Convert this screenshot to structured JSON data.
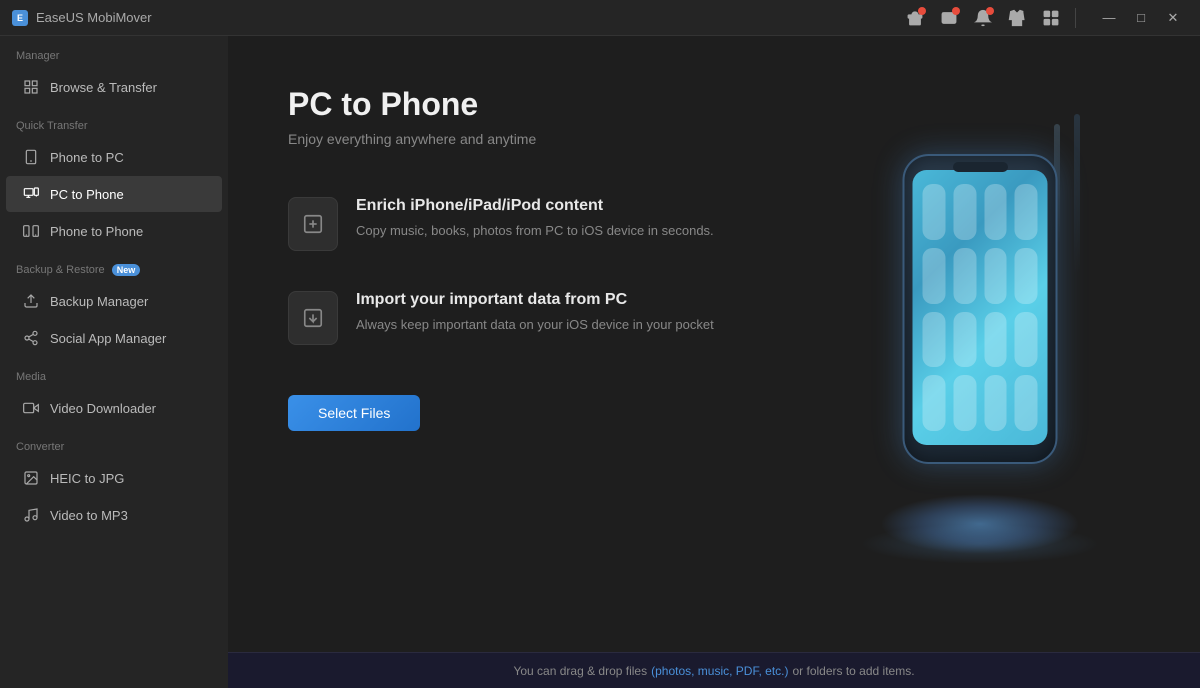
{
  "app": {
    "title": "EaseUS MobiMover",
    "logo_letter": "E"
  },
  "titlebar": {
    "icons": [
      "gift-icon",
      "email-icon",
      "bell-icon",
      "shirt-icon",
      "dropdown-icon"
    ],
    "win_controls": [
      "minimize",
      "maximize",
      "close"
    ]
  },
  "sidebar": {
    "sections": [
      {
        "label": "Manager",
        "items": [
          {
            "id": "browse-transfer",
            "label": "Browse & Transfer",
            "icon": "grid-icon"
          }
        ]
      },
      {
        "label": "Quick Transfer",
        "items": [
          {
            "id": "phone-to-pc",
            "label": "Phone to PC",
            "icon": "phone-icon"
          },
          {
            "id": "pc-to-phone",
            "label": "PC to Phone",
            "icon": "pc-phone-icon",
            "active": true
          },
          {
            "id": "phone-to-phone",
            "label": "Phone to Phone",
            "icon": "phone-phone-icon"
          }
        ]
      },
      {
        "label": "Backup & Restore",
        "badge": "New",
        "items": [
          {
            "id": "backup-manager",
            "label": "Backup Manager",
            "icon": "backup-icon"
          },
          {
            "id": "social-app-manager",
            "label": "Social App Manager",
            "icon": "social-icon"
          }
        ]
      },
      {
        "label": "Media",
        "items": [
          {
            "id": "video-downloader",
            "label": "Video Downloader",
            "icon": "video-icon"
          }
        ]
      },
      {
        "label": "Converter",
        "items": [
          {
            "id": "heic-to-jpg",
            "label": "HEIC to JPG",
            "icon": "heic-icon"
          },
          {
            "id": "video-to-mp3",
            "label": "Video to MP3",
            "icon": "mp3-icon"
          }
        ]
      }
    ]
  },
  "main": {
    "title": "PC to Phone",
    "subtitle": "Enjoy everything anywhere and anytime",
    "features": [
      {
        "id": "enrich",
        "title": "Enrich iPhone/iPad/iPod content",
        "description": "Copy music, books, photos from PC to iOS device in seconds.",
        "icon": "plus-box-icon"
      },
      {
        "id": "import",
        "title": "Import your important data from PC",
        "description": "Always keep important data on your iOS device in your pocket",
        "icon": "import-box-icon"
      }
    ],
    "select_button": "Select Files",
    "status_bar": {
      "text_before": "You can drag & drop files ",
      "link_text": "(photos, music, PDF, etc.)",
      "text_after": " or folders to add items."
    }
  }
}
